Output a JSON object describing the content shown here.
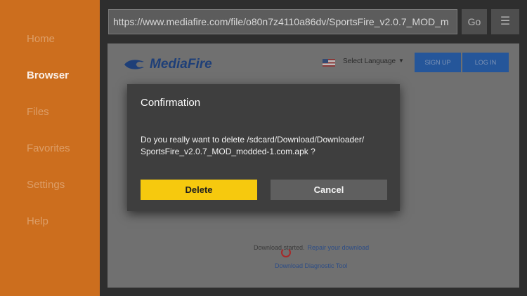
{
  "sidebar": {
    "items": [
      {
        "label": "Home"
      },
      {
        "label": "Browser"
      },
      {
        "label": "Files"
      },
      {
        "label": "Favorites"
      },
      {
        "label": "Settings"
      },
      {
        "label": "Help"
      }
    ],
    "active": "Browser",
    "color": "#cc6e1e"
  },
  "toolbar": {
    "url": "https://www.mediafire.com/file/o80n7z4110a86dv/SportsFire_v2.0.7_MOD_m",
    "go_label": "Go",
    "menu_label": "☰",
    "menu_icon": "hamburger-menu-icon"
  },
  "webpage": {
    "logo_text": "MediaFire",
    "language_label": "Select Language",
    "signup_label": "SIGN UP",
    "login_label": "LOG IN",
    "download_status": "Download started.",
    "repair_link": "Repair your download",
    "diagnostic_link": "Download Diagnostic Tool"
  },
  "dialog": {
    "title": "Confirmation",
    "message_line1": "Do you really want to delete /sdcard/Download/Downloader/",
    "message_line2": "SportsFire_v2.0.7_MOD_modded-1.com.apk ?",
    "delete_label": "Delete",
    "cancel_label": "Cancel",
    "delete_color": "#f6c90e"
  }
}
